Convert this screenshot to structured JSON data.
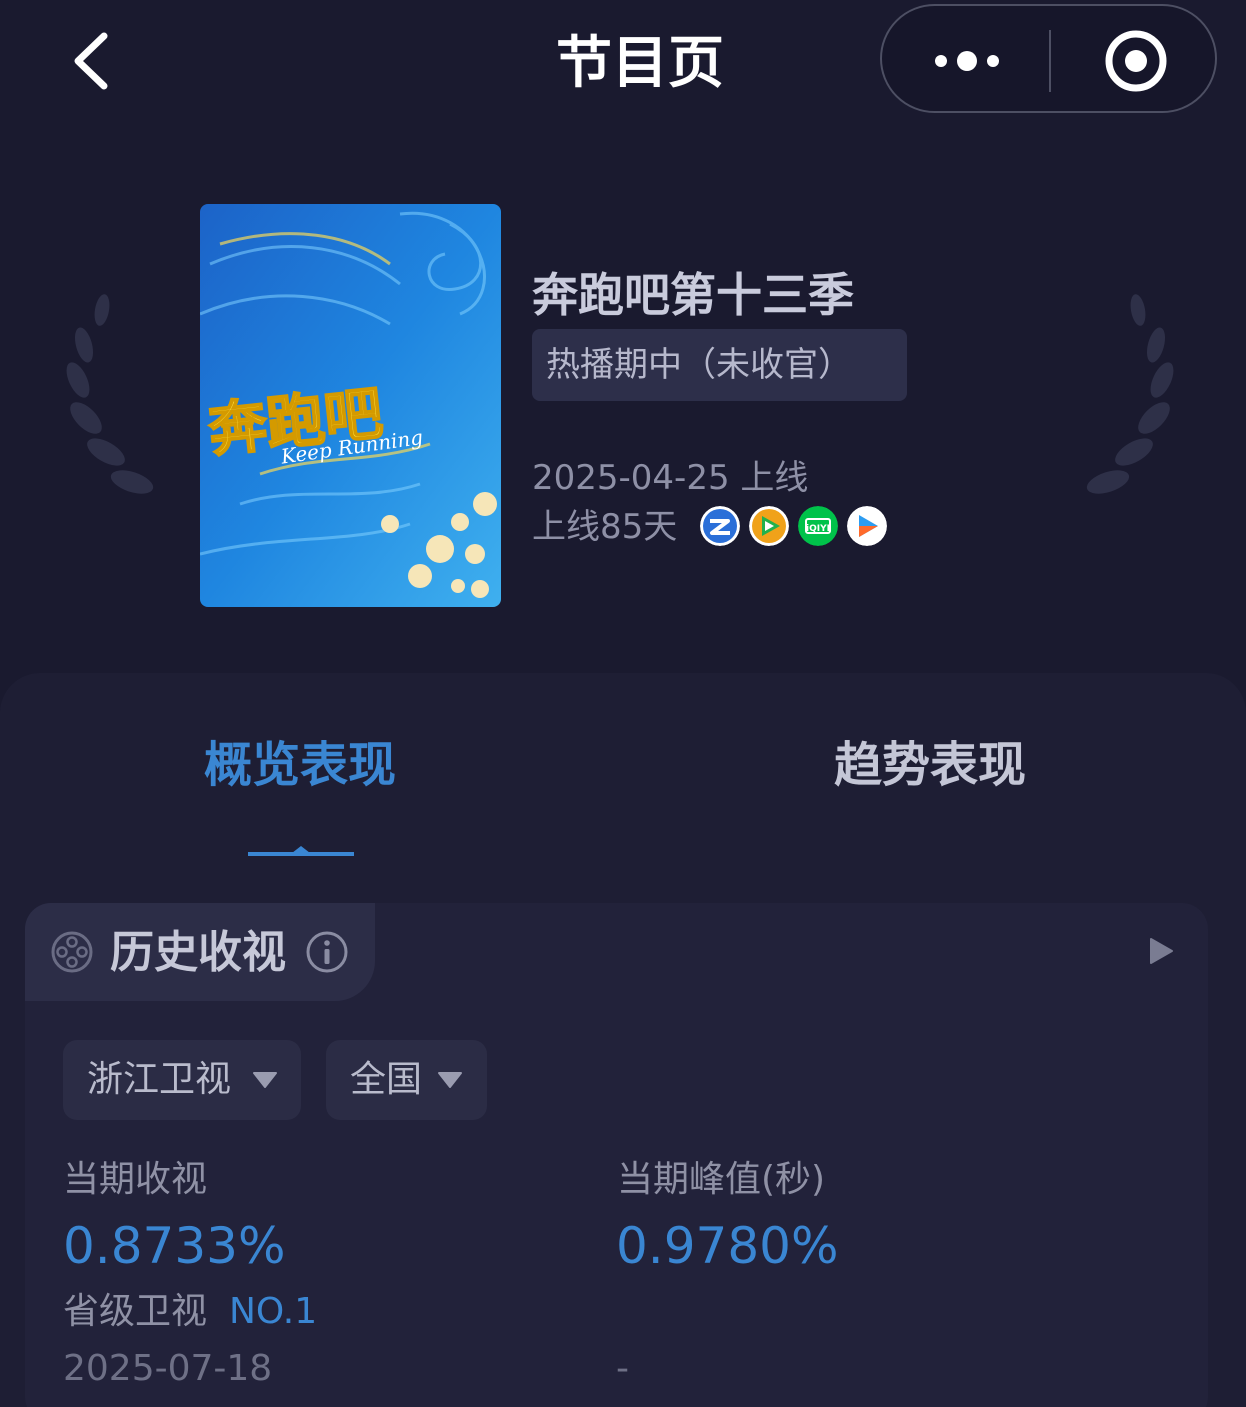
{
  "nav": {
    "title": "节目页",
    "back_icon": "chevron-left-icon",
    "more_icon": "more-dots-icon",
    "close_icon": "circle-target-icon"
  },
  "show": {
    "poster_title": "奔跑吧",
    "poster_subtitle": "Keep Running",
    "title": "奔跑吧第十三季",
    "status": "热播期中（未收官）",
    "release_date": "2025-04-25 上线",
    "days_online": "上线85天",
    "platforms": [
      {
        "icon": "zhejiang-tv-icon",
        "color": "#2b6fd8"
      },
      {
        "icon": "tencent-video-icon",
        "color": "#f0a21a"
      },
      {
        "icon": "iqiyi-icon",
        "color": "#00c24a"
      },
      {
        "icon": "youku-icon",
        "color": "#2d9cf0"
      }
    ]
  },
  "tabs": [
    {
      "label": "概览表现",
      "active": true
    },
    {
      "label": "趋势表现",
      "active": false
    }
  ],
  "card": {
    "title": "历史收视",
    "filters": {
      "channel": "浙江卫视",
      "region": "全国"
    },
    "metrics": {
      "current_rating_label": "当期收视",
      "current_rating_value": "0.8733%",
      "rank_label": "省级卫视",
      "rank_value": "NO.1",
      "current_date": "2025-07-18",
      "peak_label": "当期峰值(秒)",
      "peak_value": "0.9780%",
      "peak_date": "-"
    }
  },
  "colors": {
    "background": "#1a1a2f",
    "accent": "#3a86d2",
    "panel": "#1e1e34"
  }
}
